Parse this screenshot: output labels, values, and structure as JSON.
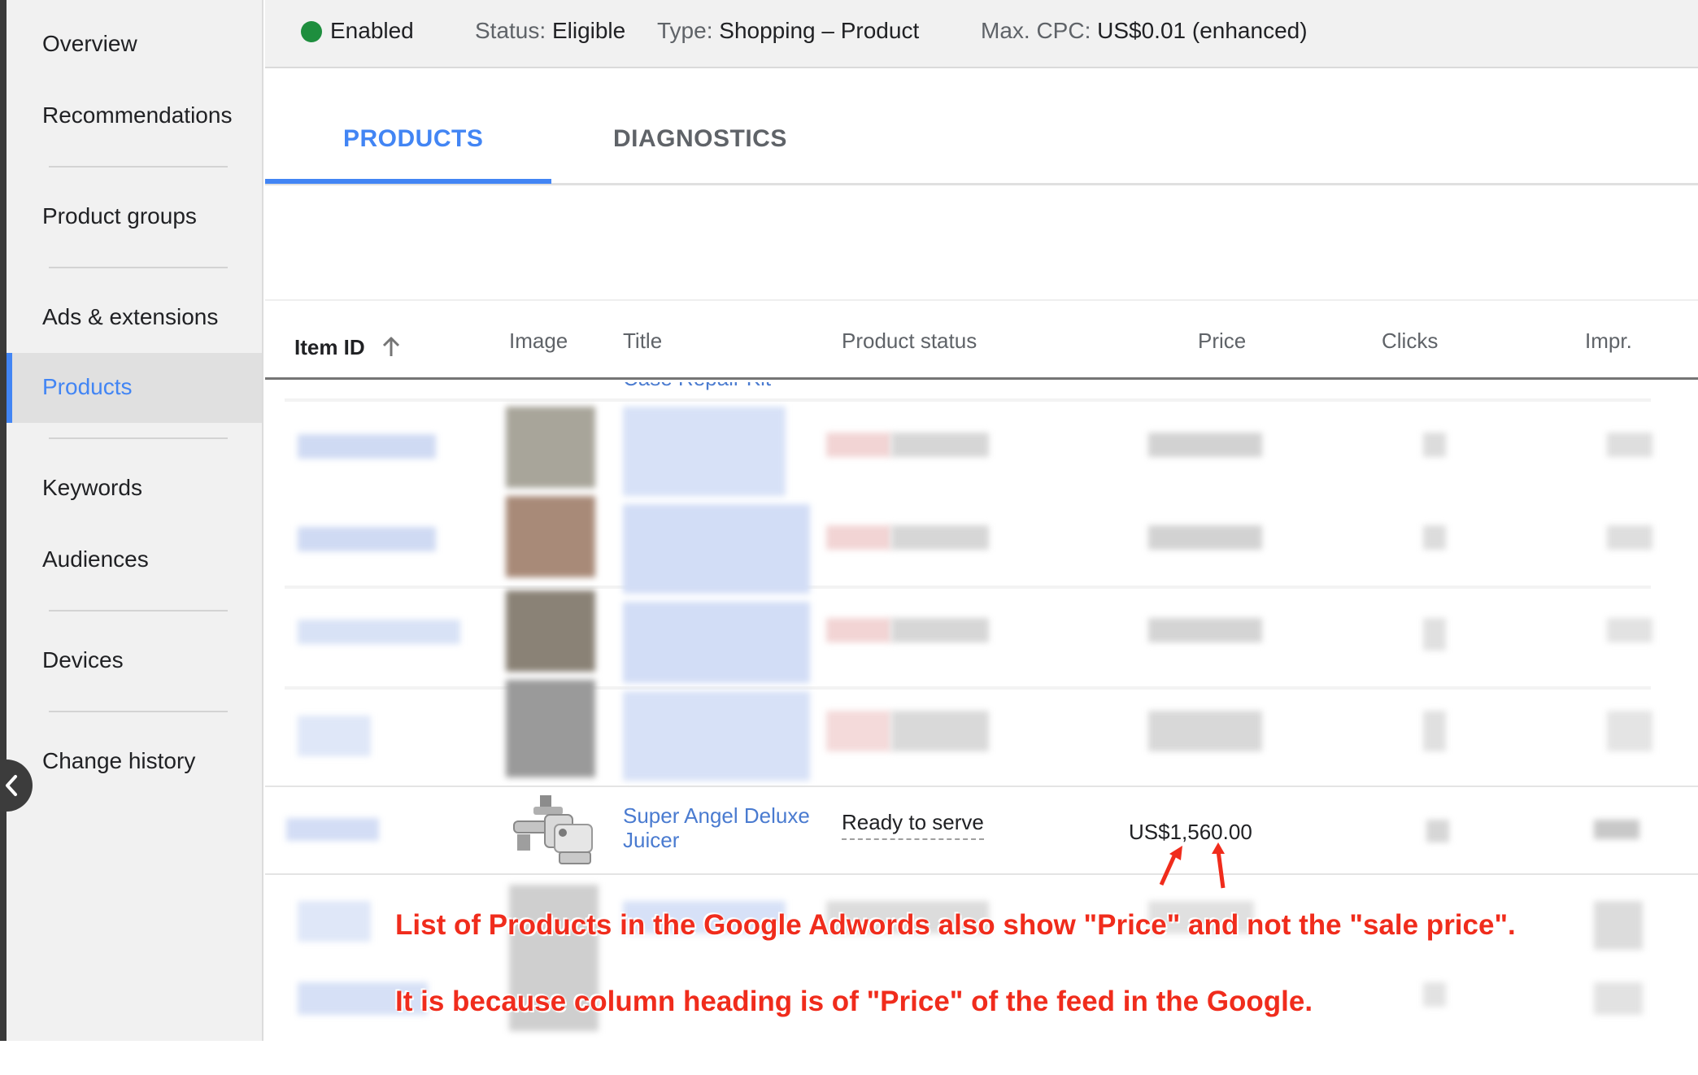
{
  "status_bar": {
    "enabled": "Enabled",
    "status_label": "Status:",
    "status_value": "Eligible",
    "type_label": "Type:",
    "type_value": "Shopping – Product",
    "cpc_label": "Max. CPC:",
    "cpc_value": "US$0.01 (enhanced)"
  },
  "sidebar": {
    "items": [
      {
        "label": "Overview"
      },
      {
        "label": "Recommendations"
      },
      {
        "label": "Product groups"
      },
      {
        "label": "Ads & extensions"
      },
      {
        "label": "Products",
        "active": true
      },
      {
        "label": "Keywords"
      },
      {
        "label": "Audiences"
      },
      {
        "label": "Devices"
      },
      {
        "label": "Change history"
      }
    ]
  },
  "tabs": [
    {
      "label": "PRODUCTS",
      "active": true
    },
    {
      "label": "DIAGNOSTICS"
    }
  ],
  "table": {
    "columns": [
      "Item ID",
      "Image",
      "Title",
      "Product status",
      "Price",
      "Clicks",
      "Impr."
    ],
    "partial_row_title": "Case  Repair Kit",
    "featured_row": {
      "title": "Super Angel Deluxe Juicer",
      "title_line1": "Super Angel Deluxe",
      "title_line2": "Juicer",
      "status": "Ready to serve",
      "price": "US$1,560.00"
    }
  },
  "annotations": {
    "line1": "List of Products in the Google Adwords also show \"Price\" and not the \"sale price\".",
    "line2": "It is because column heading is of \"Price\" of the feed in the Google."
  },
  "colors": {
    "accent": "#4285f4",
    "enabled_dot": "#1e8e3e",
    "annotation": "#f02c1c"
  }
}
